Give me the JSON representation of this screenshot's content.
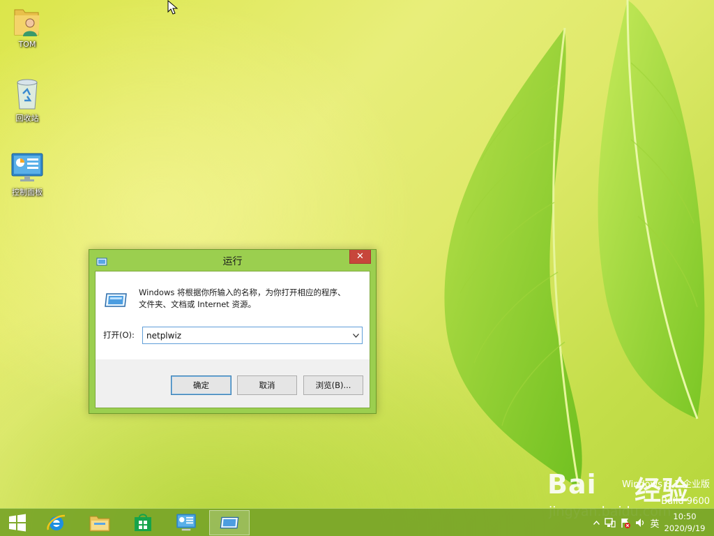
{
  "desktop": {
    "icons": [
      {
        "label": "TOM",
        "icon": "user-folder-icon"
      },
      {
        "label": "回收站",
        "icon": "recycle-bin-icon"
      },
      {
        "label": "控制面板",
        "icon": "control-panel-icon"
      }
    ]
  },
  "run_dialog": {
    "title": "运行",
    "close_glyph": "✕",
    "description_line1": "Windows 将根据你所输入的名称，为你打开相应的程序、",
    "description_line2": "文件夹、文档或 Internet 资源。",
    "open_label": "打开(O):",
    "open_value": "netplwiz",
    "ok_label": "确定",
    "cancel_label": "取消",
    "browse_label": "浏览(B)..."
  },
  "taskbar": {
    "items": [
      "start-icon",
      "internet-explorer-icon",
      "file-explorer-icon",
      "store-icon",
      "control-panel-icon",
      "run-icon"
    ],
    "active_item": "run-icon",
    "ime_label": "英",
    "time": "10:50",
    "date": "2020/9/19"
  },
  "watermark": {
    "edition": "Windows 8.1 企业版",
    "build": "Build 9600",
    "baidu_logo": "Bai",
    "baidu_logo_cn": "经验",
    "baidu_url": "jingyan.baidu.com"
  },
  "colors": {
    "desktop_green": "#dbe64a",
    "window_frame": "#9bcf4f",
    "close_red": "#c7463b",
    "taskbar": "#78a528"
  }
}
